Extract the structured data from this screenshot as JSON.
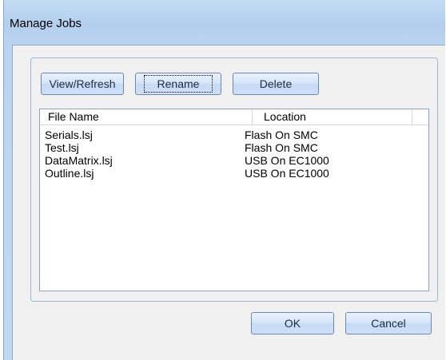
{
  "window": {
    "title": "Manage Jobs"
  },
  "toolbar": {
    "view_refresh_label": "View/Refresh",
    "rename_label": "Rename",
    "delete_label": "Delete"
  },
  "list": {
    "columns": [
      "File Name",
      "Location"
    ],
    "rows": [
      {
        "file_name": "Serials.lsj",
        "location": "Flash On SMC"
      },
      {
        "file_name": "Test.lsj",
        "location": "Flash On SMC"
      },
      {
        "file_name": "DataMatrix.lsj",
        "location": "USB On EC1000"
      },
      {
        "file_name": "Outline.lsj",
        "location": "USB On EC1000"
      }
    ]
  },
  "footer": {
    "ok_label": "OK",
    "cancel_label": "Cancel"
  },
  "colors": {
    "titlebar": "#b9d3ef",
    "button_border": "#6d88b0",
    "client_background": "#f0f0f0"
  }
}
